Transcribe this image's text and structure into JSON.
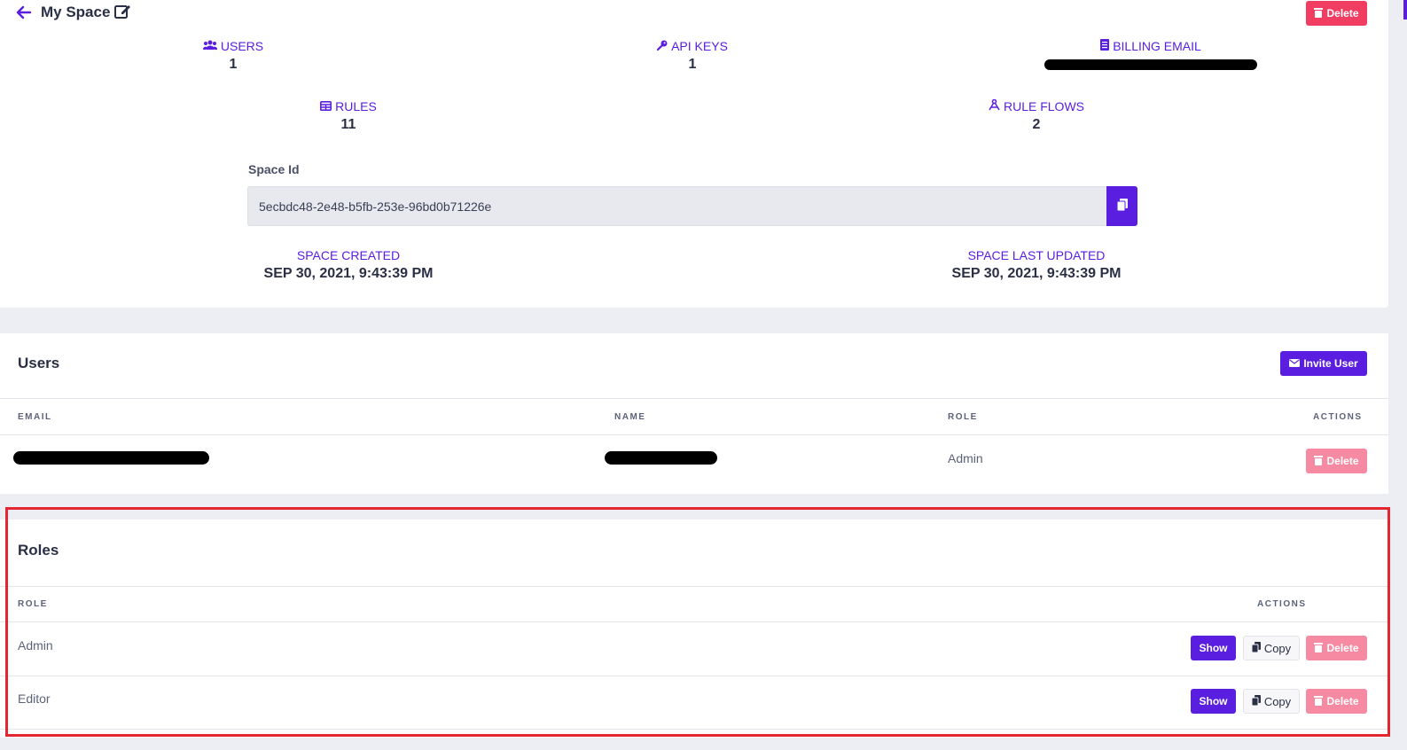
{
  "header": {
    "title": "My Space",
    "delete_label": "Delete"
  },
  "stats": {
    "users": {
      "label": "USERS",
      "value": "1"
    },
    "api_keys": {
      "label": "API KEYS",
      "value": "1"
    },
    "billing_email": {
      "label": "BILLING EMAIL"
    },
    "rules": {
      "label": "RULES",
      "value": "11"
    },
    "rule_flows": {
      "label": "RULE FLOWS",
      "value": "2"
    }
  },
  "space_id": {
    "label": "Space Id",
    "value": "5ecbdc48-2e48-b5fb-253e-96bd0b71226e"
  },
  "dates": {
    "created_label": "SPACE CREATED",
    "created_value": "SEP 30, 2021, 9:43:39 PM",
    "updated_label": "SPACE LAST UPDATED",
    "updated_value": "SEP 30, 2021, 9:43:39 PM"
  },
  "users_section": {
    "title": "Users",
    "invite_label": "Invite User",
    "columns": [
      "EMAIL",
      "NAME",
      "ROLE",
      "ACTIONS"
    ],
    "rows": [
      {
        "role": "Admin",
        "delete_label": "Delete"
      }
    ]
  },
  "roles_section": {
    "title": "Roles",
    "columns": [
      "ROLE",
      "ACTIONS"
    ],
    "rows": [
      {
        "role": "Admin",
        "show_label": "Show",
        "copy_label": "Copy",
        "delete_label": "Delete"
      },
      {
        "role": "Editor",
        "show_label": "Show",
        "copy_label": "Copy",
        "delete_label": "Delete"
      }
    ]
  },
  "colors": {
    "accent": "#5a1ee0",
    "danger": "#f23d63",
    "danger_light": "#f58aa2",
    "highlight_border": "#e3262f"
  },
  "icons": [
    "back-arrow-icon",
    "edit-icon",
    "trash-icon",
    "users-icon",
    "key-icon",
    "receipt-icon",
    "table-icon",
    "flow-icon",
    "copy-icon",
    "envelope-icon"
  ]
}
